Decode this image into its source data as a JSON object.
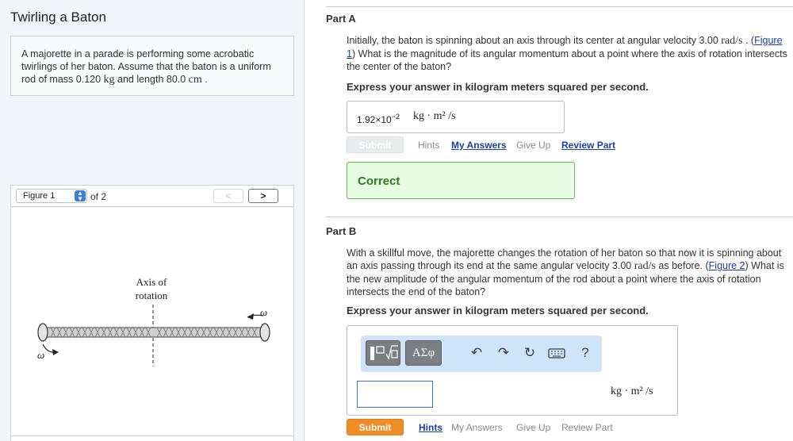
{
  "problem": {
    "title": "Twirling a Baton",
    "text_1": "A majorette in a parade is performing some acrobatic twirlings of her baton. Assume that the baton is a uniform rod of mass 0.120 ",
    "mass_unit": "kg",
    "text_2": " and length 80.0 ",
    "length_unit": "cm",
    "text_3": " ."
  },
  "figure_nav": {
    "selected": "Figure 1",
    "of_label": "of 2",
    "prev": "<",
    "next": ">"
  },
  "figure": {
    "axis_label_1": "Axis of",
    "axis_label_2": "rotation",
    "omega_symbol": "ω"
  },
  "part_a": {
    "title": "Part A",
    "q_1": "Initially, the baton is spinning about an axis through its center at angular velocity 3.00 ",
    "q_unit": "rad/s",
    "q_2": " . (",
    "fig_link": "Figure 1",
    "q_3": ") What is the magnitude of its angular momentum about a point where the axis of rotation intersects the center of the baton?",
    "instruction": "Express your answer in kilogram meters squared per second.",
    "answer_mantissa": "1.92×10",
    "answer_exponent": "−2",
    "answer_unit": "kg · m² /s",
    "submit": "Submit",
    "hints": "Hints",
    "my_answers": "My Answers",
    "give_up": "Give Up",
    "review_part": "Review Part",
    "status": "Correct"
  },
  "part_b": {
    "title": "Part B",
    "q_1": "With a skillful move, the majorette changes the rotation of her baton so that now it is spinning about an axis passing through its end at the same angular velocity 3.00 ",
    "q_unit": "rad/s",
    "q_2": " as before. (",
    "fig_link": "Figure 2",
    "q_3": ") What is the new amplitude of the angular momentum of the rod about a point where the axis of rotation intersects the end of the baton?",
    "instruction": "Express your answer in kilogram meters squared per second.",
    "symbols_label": "ΑΣφ",
    "help_label": "?",
    "answer_value": "",
    "answer_unit": "kg · m² /s",
    "submit": "Submit",
    "hints": "Hints",
    "my_answers": "My Answers",
    "give_up": "Give Up",
    "review_part": "Review Part"
  },
  "icons": {
    "undo": "undo-icon",
    "redo": "redo-icon",
    "reset": "reset-icon",
    "keyboard": "keyboard-icon",
    "templates": "templates-icon"
  },
  "colors": {
    "submit_active": "#f08c25",
    "correct_border": "#5fc04a",
    "correct_text": "#2e7d1f",
    "link": "#1a3fa8",
    "toolbar_bg": "#cfe3fb"
  }
}
